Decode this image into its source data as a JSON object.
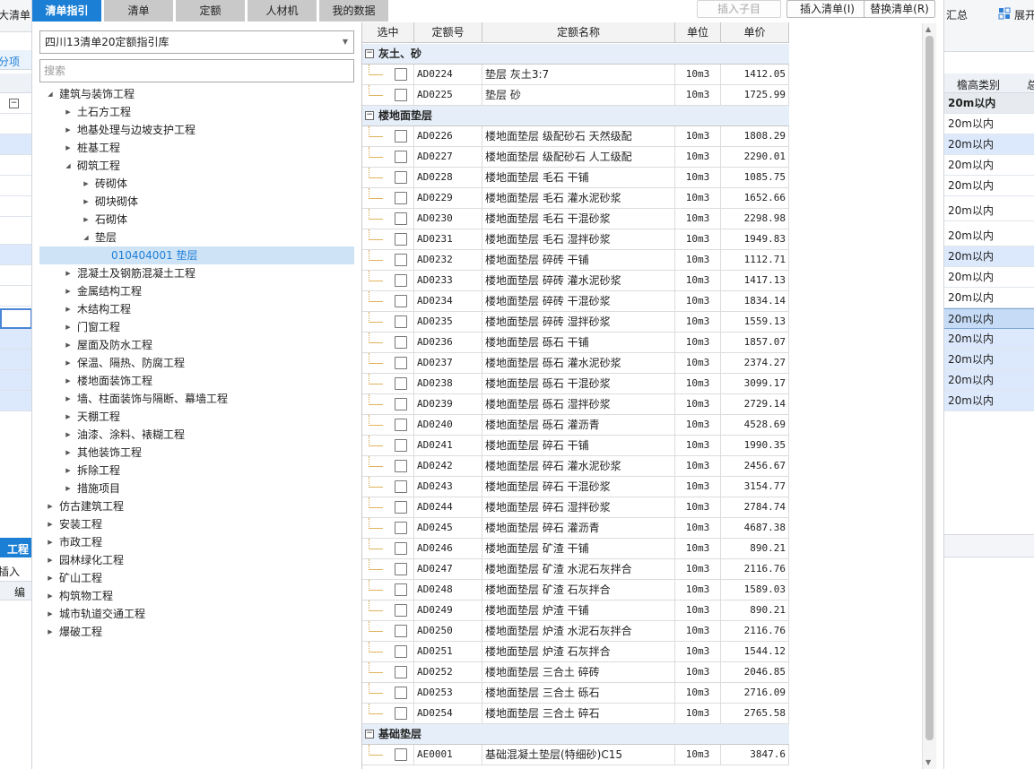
{
  "background": {
    "left_strip": {
      "toolbar_text": "大清单",
      "tab_text": "分项",
      "lower_tab_text": "工程",
      "insert_text": "插入",
      "edit_text": "编"
    },
    "right_strip": {
      "toolbar_summary": "汇总",
      "toolbar_expand": "展开",
      "column_header": "檐高类别",
      "column_header_extra": "总",
      "rows": [
        "20m以内",
        "20m以内",
        "20m以内",
        "20m以内",
        "20m以内",
        "20m以内",
        "20m以内",
        "20m以内",
        "20m以内",
        "20m以内",
        "20m以内",
        "20m以内",
        "20m以内",
        "20m以内"
      ]
    }
  },
  "tabs": [
    "清单指引",
    "清单",
    "定额",
    "人材机",
    "我的数据"
  ],
  "active_tab": 0,
  "buttons": {
    "insert_child": "插入子目",
    "insert_list": "插入清单(I)",
    "replace_list": "替换清单(R)"
  },
  "library_select": {
    "value": "四川13清单20定额指引库"
  },
  "search": {
    "placeholder": "搜索",
    "value": ""
  },
  "tree": [
    {
      "label": "建筑与装饰工程",
      "level": 0,
      "state": "expanded"
    },
    {
      "label": "土石方工程",
      "level": 1,
      "state": "collapsed"
    },
    {
      "label": "地基处理与边坡支护工程",
      "level": 1,
      "state": "collapsed"
    },
    {
      "label": "桩基工程",
      "level": 1,
      "state": "collapsed"
    },
    {
      "label": "砌筑工程",
      "level": 1,
      "state": "expanded"
    },
    {
      "label": "砖砌体",
      "level": 2,
      "state": "collapsed"
    },
    {
      "label": "砌块砌体",
      "level": 2,
      "state": "collapsed"
    },
    {
      "label": "石砌体",
      "level": 2,
      "state": "collapsed"
    },
    {
      "label": "垫层",
      "level": 2,
      "state": "expanded"
    },
    {
      "label": "010404001  垫层",
      "level": 3,
      "state": "leaf",
      "selected": true
    },
    {
      "label": "混凝土及钢筋混凝土工程",
      "level": 1,
      "state": "collapsed"
    },
    {
      "label": "金属结构工程",
      "level": 1,
      "state": "collapsed"
    },
    {
      "label": "木结构工程",
      "level": 1,
      "state": "collapsed"
    },
    {
      "label": "门窗工程",
      "level": 1,
      "state": "collapsed"
    },
    {
      "label": "屋面及防水工程",
      "level": 1,
      "state": "collapsed"
    },
    {
      "label": "保温、隔热、防腐工程",
      "level": 1,
      "state": "collapsed"
    },
    {
      "label": "楼地面装饰工程",
      "level": 1,
      "state": "collapsed"
    },
    {
      "label": "墙、柱面装饰与隔断、幕墙工程",
      "level": 1,
      "state": "collapsed"
    },
    {
      "label": "天棚工程",
      "level": 1,
      "state": "collapsed"
    },
    {
      "label": "油漆、涂料、裱糊工程",
      "level": 1,
      "state": "collapsed"
    },
    {
      "label": "其他装饰工程",
      "level": 1,
      "state": "collapsed"
    },
    {
      "label": "拆除工程",
      "level": 1,
      "state": "collapsed"
    },
    {
      "label": "措施项目",
      "level": 1,
      "state": "collapsed"
    },
    {
      "label": "仿古建筑工程",
      "level": 0,
      "state": "collapsed"
    },
    {
      "label": "安装工程",
      "level": 0,
      "state": "collapsed"
    },
    {
      "label": "市政工程",
      "level": 0,
      "state": "collapsed"
    },
    {
      "label": "园林绿化工程",
      "level": 0,
      "state": "collapsed"
    },
    {
      "label": "矿山工程",
      "level": 0,
      "state": "collapsed"
    },
    {
      "label": "构筑物工程",
      "level": 0,
      "state": "collapsed"
    },
    {
      "label": "城市轨道交通工程",
      "level": 0,
      "state": "collapsed"
    },
    {
      "label": "爆破工程",
      "level": 0,
      "state": "collapsed"
    }
  ],
  "table": {
    "headers": [
      "选中",
      "定额号",
      "定额名称",
      "单位",
      "单价"
    ],
    "groups": [
      {
        "name": "灰土、砂",
        "collapse_symbol": "−",
        "rows": [
          {
            "code": "AD0224",
            "name": "垫层 灰土3:7",
            "unit": "10m3",
            "price": "1412.05"
          },
          {
            "code": "AD0225",
            "name": "垫层 砂",
            "unit": "10m3",
            "price": "1725.99"
          }
        ]
      },
      {
        "name": "楼地面垫层",
        "collapse_symbol": "−",
        "rows": [
          {
            "code": "AD0226",
            "name": "楼地面垫层 级配砂石 天然级配",
            "unit": "10m3",
            "price": "1808.29"
          },
          {
            "code": "AD0227",
            "name": "楼地面垫层 级配砂石 人工级配",
            "unit": "10m3",
            "price": "2290.01"
          },
          {
            "code": "AD0228",
            "name": "楼地面垫层 毛石 干铺",
            "unit": "10m3",
            "price": "1085.75"
          },
          {
            "code": "AD0229",
            "name": "楼地面垫层 毛石 灌水泥砂浆",
            "unit": "10m3",
            "price": "1652.66"
          },
          {
            "code": "AD0230",
            "name": "楼地面垫层 毛石 干混砂浆",
            "unit": "10m3",
            "price": "2298.98"
          },
          {
            "code": "AD0231",
            "name": "楼地面垫层 毛石 湿拌砂浆",
            "unit": "10m3",
            "price": "1949.83"
          },
          {
            "code": "AD0232",
            "name": "楼地面垫层 碎砖 干铺",
            "unit": "10m3",
            "price": "1112.71"
          },
          {
            "code": "AD0233",
            "name": "楼地面垫层 碎砖 灌水泥砂浆",
            "unit": "10m3",
            "price": "1417.13"
          },
          {
            "code": "AD0234",
            "name": "楼地面垫层 碎砖 干混砂浆",
            "unit": "10m3",
            "price": "1834.14"
          },
          {
            "code": "AD0235",
            "name": "楼地面垫层 碎砖 湿拌砂浆",
            "unit": "10m3",
            "price": "1559.13"
          },
          {
            "code": "AD0236",
            "name": "楼地面垫层 砾石 干铺",
            "unit": "10m3",
            "price": "1857.07"
          },
          {
            "code": "AD0237",
            "name": "楼地面垫层 砾石 灌水泥砂浆",
            "unit": "10m3",
            "price": "2374.27"
          },
          {
            "code": "AD0238",
            "name": "楼地面垫层 砾石 干混砂浆",
            "unit": "10m3",
            "price": "3099.17"
          },
          {
            "code": "AD0239",
            "name": "楼地面垫层 砾石 湿拌砂浆",
            "unit": "10m3",
            "price": "2729.14"
          },
          {
            "code": "AD0240",
            "name": "楼地面垫层 砾石 灌沥青",
            "unit": "10m3",
            "price": "4528.69"
          },
          {
            "code": "AD0241",
            "name": "楼地面垫层 碎石 干铺",
            "unit": "10m3",
            "price": "1990.35"
          },
          {
            "code": "AD0242",
            "name": "楼地面垫层 碎石 灌水泥砂浆",
            "unit": "10m3",
            "price": "2456.67"
          },
          {
            "code": "AD0243",
            "name": "楼地面垫层 碎石 干混砂浆",
            "unit": "10m3",
            "price": "3154.77"
          },
          {
            "code": "AD0244",
            "name": "楼地面垫层 碎石 湿拌砂浆",
            "unit": "10m3",
            "price": "2784.74"
          },
          {
            "code": "AD0245",
            "name": "楼地面垫层 碎石 灌沥青",
            "unit": "10m3",
            "price": "4687.38"
          },
          {
            "code": "AD0246",
            "name": "楼地面垫层 矿渣 干铺",
            "unit": "10m3",
            "price": "890.21"
          },
          {
            "code": "AD0247",
            "name": "楼地面垫层 矿渣 水泥石灰拌合",
            "unit": "10m3",
            "price": "2116.76"
          },
          {
            "code": "AD0248",
            "name": "楼地面垫层 矿渣 石灰拌合",
            "unit": "10m3",
            "price": "1589.03"
          },
          {
            "code": "AD0249",
            "name": "楼地面垫层 炉渣 干铺",
            "unit": "10m3",
            "price": "890.21"
          },
          {
            "code": "AD0250",
            "name": "楼地面垫层 炉渣 水泥石灰拌合",
            "unit": "10m3",
            "price": "2116.76"
          },
          {
            "code": "AD0251",
            "name": "楼地面垫层 炉渣 石灰拌合",
            "unit": "10m3",
            "price": "1544.12"
          },
          {
            "code": "AD0252",
            "name": "楼地面垫层 三合土 碎砖",
            "unit": "10m3",
            "price": "2046.85"
          },
          {
            "code": "AD0253",
            "name": "楼地面垫层 三合土 砾石",
            "unit": "10m3",
            "price": "2716.09"
          },
          {
            "code": "AD0254",
            "name": "楼地面垫层 三合土 碎石",
            "unit": "10m3",
            "price": "2765.58"
          }
        ]
      },
      {
        "name": "基础垫层",
        "collapse_symbol": "−",
        "rows": [
          {
            "code": "AE0001",
            "name": "基础混凝土垫层(特细砂)C15",
            "unit": "10m3",
            "price": "3847.6"
          }
        ]
      }
    ]
  },
  "colors": {
    "accent": "#1c7fd6",
    "selected_node_bg": "#cfe3f7",
    "group_bg": "#e6eff9"
  }
}
